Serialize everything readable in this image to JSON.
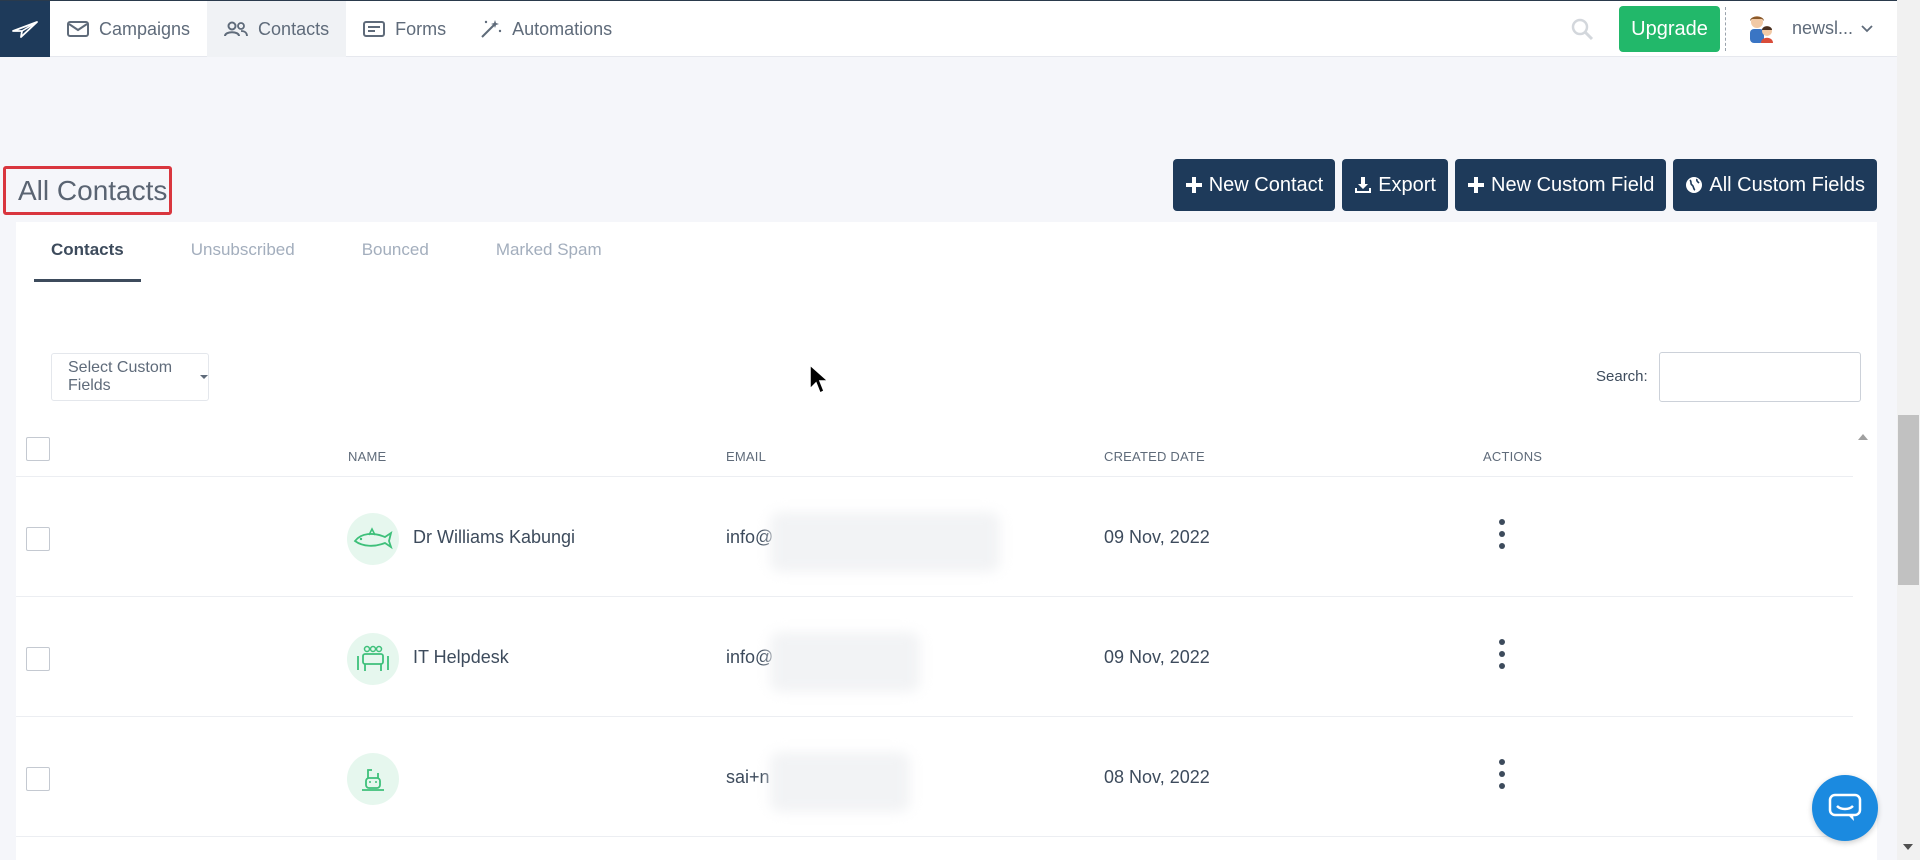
{
  "nav": {
    "items": [
      {
        "label": "Campaigns",
        "icon": "envelope-icon",
        "active": false
      },
      {
        "label": "Contacts",
        "icon": "users-icon",
        "active": true
      },
      {
        "label": "Forms",
        "icon": "form-icon",
        "active": false
      },
      {
        "label": "Automations",
        "icon": "magic-wand-icon",
        "active": false
      }
    ],
    "upgrade_label": "Upgrade",
    "account_label": "newsl..."
  },
  "header": {
    "title": "All Contacts",
    "buttons": {
      "new_contact": "New Contact",
      "export": "Export",
      "new_custom_field": "New Custom Field",
      "all_custom_fields": "All Custom Fields"
    }
  },
  "tabs": [
    "Contacts",
    "Unsubscribed",
    "Bounced",
    "Marked Spam"
  ],
  "filters": {
    "select_custom_fields": "Select Custom Fields",
    "search_label": "Search:",
    "search_value": ""
  },
  "table": {
    "columns": {
      "name": "NAME",
      "email": "EMAIL",
      "created": "CREATED DATE",
      "actions": "ACTIONS"
    },
    "rows": [
      {
        "name": "Dr Williams Kabungi",
        "email": "info@",
        "created": "09 Nov, 2022",
        "avatar_icon": "shark-icon"
      },
      {
        "name": "IT Helpdesk",
        "email": "info@",
        "created": "09 Nov, 2022",
        "avatar_icon": "group-icon"
      },
      {
        "name": "",
        "email": "sai+n",
        "created": "08 Nov, 2022",
        "avatar_icon": "crab-icon"
      }
    ]
  },
  "colors": {
    "brand": "#1e3a5a",
    "upgrade": "#22b86a",
    "highlight": "#d9363e",
    "chat": "#1b8ae0"
  }
}
